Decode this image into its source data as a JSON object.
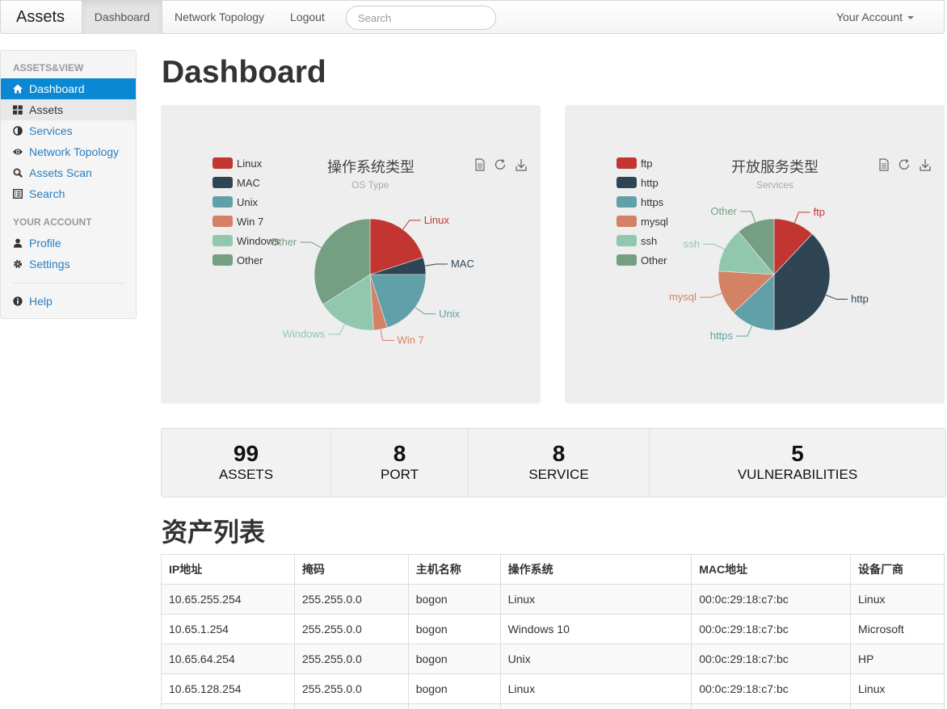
{
  "navbar": {
    "brand": "Assets",
    "links": [
      "Dashboard",
      "Network Topology",
      "Logout"
    ],
    "search_placeholder": "Search",
    "account": "Your Account"
  },
  "sidebar": {
    "header_main": "ASSETS&VIEW",
    "items_main": [
      {
        "label": "Dashboard",
        "icon": "home-icon"
      },
      {
        "label": "Assets",
        "icon": "th-large-icon"
      },
      {
        "label": "Services",
        "icon": "adjust-icon"
      },
      {
        "label": "Network Topology",
        "icon": "eye-icon"
      },
      {
        "label": "Assets Scan",
        "icon": "search-icon"
      },
      {
        "label": "Search",
        "icon": "list-alt-icon"
      }
    ],
    "header_account": "YOUR ACCOUNT",
    "items_account": [
      {
        "label": "Profile",
        "icon": "user-icon"
      },
      {
        "label": "Settings",
        "icon": "cog-icon"
      }
    ],
    "help": {
      "label": "Help",
      "icon": "info-sign-icon"
    }
  },
  "page_title": "Dashboard",
  "charts": {
    "os": {
      "title": "操作系统类型",
      "subtitle": "OS Type",
      "legend": [
        "Linux",
        "MAC",
        "Unix",
        "Win 7",
        "Windows",
        "Other"
      ],
      "pie_labels": [
        "Linux",
        "MAC",
        "Unix",
        "Win 7",
        "Windows",
        "Other"
      ]
    },
    "services": {
      "title": "开放服务类型",
      "subtitle": "Services",
      "legend": [
        "ftp",
        "http",
        "https",
        "mysql",
        "ssh",
        "Other"
      ],
      "pie_labels": [
        "ftp",
        "http",
        "https",
        "mysql",
        "ssh",
        "Other"
      ]
    }
  },
  "chart_data": [
    {
      "type": "pie",
      "title": "操作系统类型",
      "subtitle": "OS Type",
      "legend_placement": "top-left",
      "categories": [
        "Linux",
        "MAC",
        "Unix",
        "Win 7",
        "Windows",
        "Other"
      ],
      "values": [
        20,
        5,
        20,
        4,
        17,
        34
      ],
      "colors": [
        "#c23531",
        "#2f4554",
        "#61a0a8",
        "#d48265",
        "#91c7ae",
        "#749f83"
      ]
    },
    {
      "type": "pie",
      "title": "开放服务类型",
      "subtitle": "Services",
      "legend_placement": "top-left",
      "categories": [
        "ftp",
        "http",
        "https",
        "mysql",
        "ssh",
        "Other"
      ],
      "values": [
        12,
        38,
        13,
        13,
        13,
        11
      ],
      "colors": [
        "#c23531",
        "#2f4554",
        "#61a0a8",
        "#d48265",
        "#91c7ae",
        "#749f83"
      ]
    }
  ],
  "stats": [
    {
      "num": "99",
      "label": "ASSETS"
    },
    {
      "num": "8",
      "label": "PORT"
    },
    {
      "num": "8",
      "label": "SERVICE"
    },
    {
      "num": "5",
      "label": "VULNERABILITIES"
    }
  ],
  "asset_list": {
    "title": "资产列表",
    "columns": [
      "IP地址",
      "掩码",
      "主机名称",
      "操作系统",
      "MAC地址",
      "设备厂商"
    ],
    "rows": [
      [
        "10.65.255.254",
        "255.255.0.0",
        "bogon",
        "Linux",
        "00:0c:29:18:c7:bc",
        "Linux"
      ],
      [
        "10.65.1.254",
        "255.255.0.0",
        "bogon",
        "Windows 10",
        "00:0c:29:18:c7:bc",
        "Microsoft"
      ],
      [
        "10.65.64.254",
        "255.255.0.0",
        "bogon",
        "Unix",
        "00:0c:29:18:c7:bc",
        "HP"
      ],
      [
        "10.65.128.254",
        "255.255.0.0",
        "bogon",
        "Linux",
        "00:0c:29:18:c7:bc",
        "Linux"
      ],
      [
        "",
        "",
        "",
        "",
        "",
        ""
      ]
    ]
  }
}
